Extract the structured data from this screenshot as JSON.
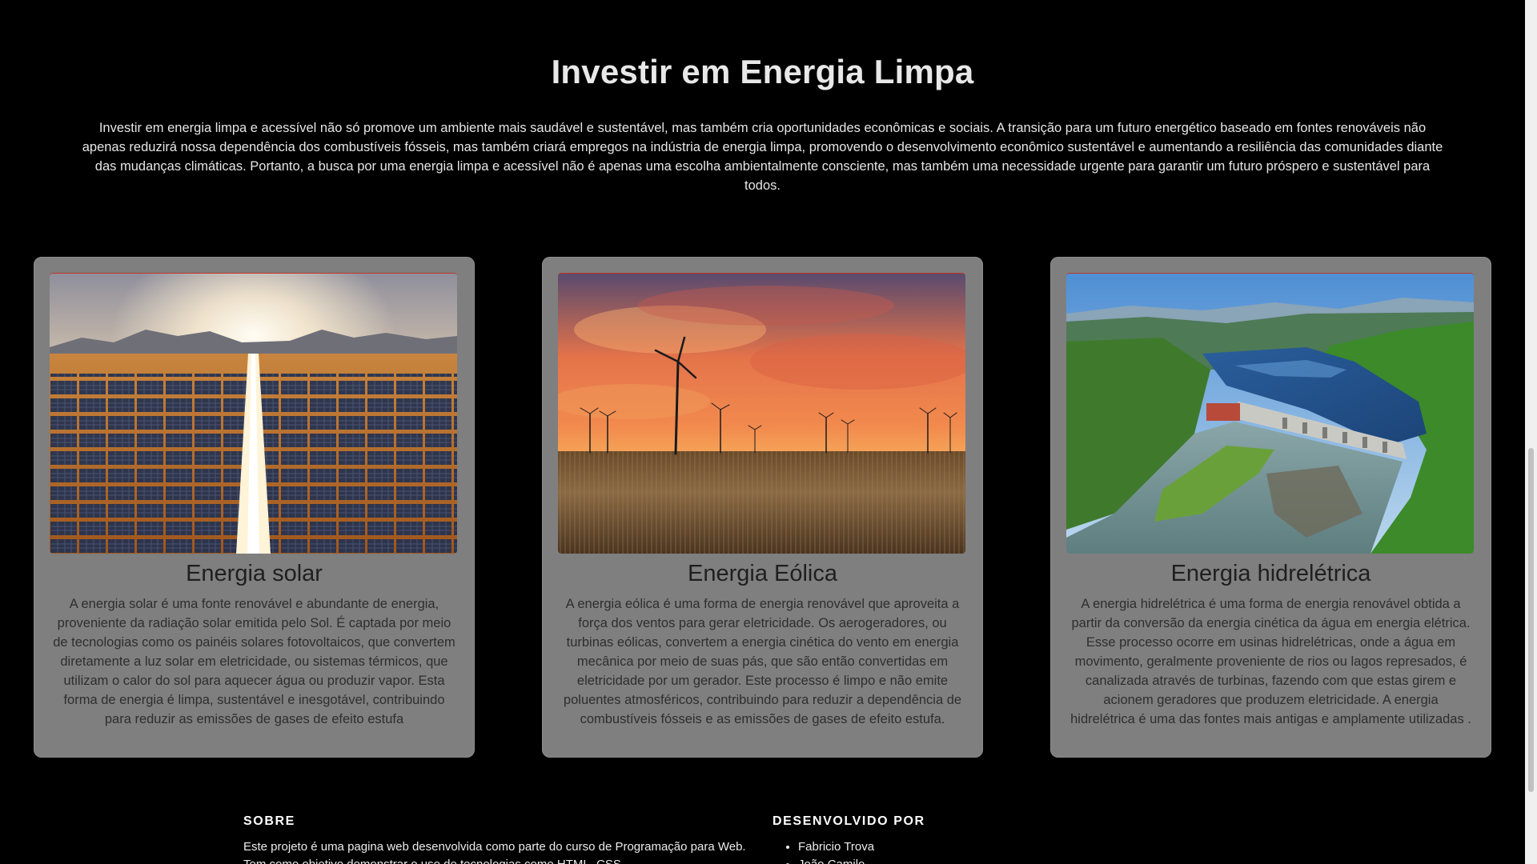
{
  "hero": {
    "title": "Investir em Energia Limpa",
    "text": "Investir em energia limpa e acessível não só promove um ambiente mais saudável e sustentável, mas também cria oportunidades econômicas e sociais. A transição para um futuro energético baseado em fontes renováveis não apenas reduzirá nossa dependência dos combustíveis fósseis, mas também criará empregos na indústria de energia limpa, promovendo o desenvolvimento econômico sustentável e aumentando a resiliência das comunidades diante das mudanças climáticas. Portanto, a busca por uma energia limpa e acessível não é apenas uma escolha ambientalmente consciente, mas também uma necessidade urgente para garantir um futuro próspero e sustentável para todos."
  },
  "cards": [
    {
      "title": "Energia solar",
      "text": "A energia solar é uma fonte renovável e abundante de energia, proveniente da radiação solar emitida pelo Sol. É captada por meio de tecnologias como os painéis solares fotovoltaicos, que convertem diretamente a luz solar em eletricidade, ou sistemas térmicos, que utilizam o calor do sol para aquecer água ou produzir vapor. Esta forma de energia é limpa, sustentável e inesgotável, contribuindo para reduzir as emissões de gases de efeito estufa"
    },
    {
      "title": "Energia Eólica",
      "text": "A energia eólica é uma forma de energia renovável que aproveita a força dos ventos para gerar eletricidade. Os aerogeradores, ou turbinas eólicas, convertem a energia cinética do vento em energia mecânica por meio de suas pás, que são então convertidas em eletricidade por um gerador. Este processo é limpo e não emite poluentes atmosféricos, contribuindo para reduzir a dependência de combustíveis fósseis e as emissões de gases de efeito estufa."
    },
    {
      "title": "Energia hidrelétrica",
      "text": "A energia hidrelétrica é uma forma de energia renovável obtida a partir da conversão da energia cinética da água em energia elétrica. Esse processo ocorre em usinas hidrelétricas, onde a água em movimento, geralmente proveniente de rios ou lagos represados, é canalizada através de turbinas, fazendo com que estas girem e acionem geradores que produzem eletricidade. A energia hidrelétrica é uma das fontes mais antigas e amplamente utilizadas ."
    }
  ],
  "footer": {
    "about_heading": "SOBRE",
    "about_text": "Este projeto é uma pagina web desenvolvida como parte do curso de Programação para Web. Tem como objetivo demonstrar o uso de tecnologias como HTML, CSS.",
    "dev_heading": "DESENVOLVIDO POR",
    "developers": [
      "Fabricio Trova",
      "João Camilo"
    ]
  }
}
